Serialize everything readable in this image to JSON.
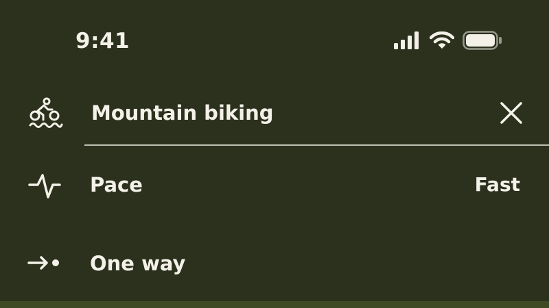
{
  "status_bar": {
    "time": "9:41",
    "icons": [
      "cellular-signal-icon",
      "wifi-icon",
      "battery-icon"
    ]
  },
  "search": {
    "activity_icon": "cycling-icon",
    "value": "Mountain biking",
    "clear_icon": "close-icon"
  },
  "options": [
    {
      "icon": "pulse-icon",
      "label": "Pace",
      "value": "Fast"
    },
    {
      "icon": "arrow-to-dot-icon",
      "label": "One way"
    }
  ],
  "colors": {
    "background": "#2c311e",
    "foreground": "#f3f1e8",
    "divider": "#bfc1b3",
    "bottom_strip": "#3d4a23"
  }
}
